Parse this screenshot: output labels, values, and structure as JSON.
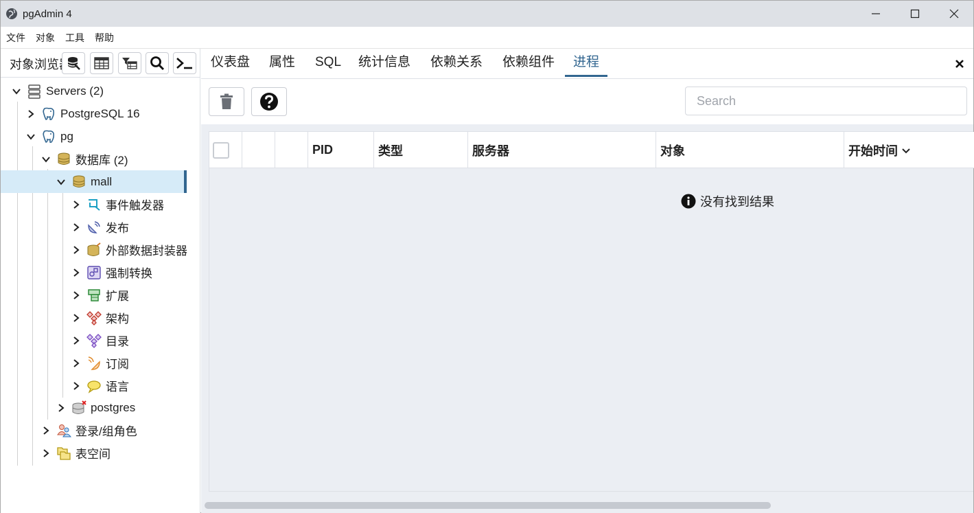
{
  "window": {
    "title": "pgAdmin 4"
  },
  "menu": [
    "文件",
    "对象",
    "工具",
    "帮助"
  ],
  "browser": {
    "title": "对象浏览器",
    "tree": [
      {
        "label": "Servers (2)",
        "icon": "servers-icon",
        "level": 0,
        "expanded": true
      },
      {
        "label": "PostgreSQL 16",
        "icon": "postgres-elephant-icon",
        "level": 1,
        "expanded": false
      },
      {
        "label": "pg",
        "icon": "postgres-elephant-icon",
        "level": 1,
        "expanded": true
      },
      {
        "label": "数据库 (2)",
        "icon": "databases-icon",
        "level": 2,
        "expanded": true
      },
      {
        "label": "mall",
        "icon": "database-icon",
        "level": 3,
        "expanded": true,
        "selected": true
      },
      {
        "label": "事件触发器",
        "icon": "event-trigger-icon",
        "level": 4
      },
      {
        "label": "发布",
        "icon": "publication-icon",
        "level": 4
      },
      {
        "label": "外部数据封装器",
        "icon": "fdw-icon",
        "level": 4
      },
      {
        "label": "强制转换",
        "icon": "cast-icon",
        "level": 4
      },
      {
        "label": "扩展",
        "icon": "extension-icon",
        "level": 4
      },
      {
        "label": "架构",
        "icon": "schema-icon",
        "level": 4
      },
      {
        "label": "目录",
        "icon": "catalog-icon",
        "level": 4
      },
      {
        "label": "订阅",
        "icon": "subscription-icon",
        "level": 4
      },
      {
        "label": "语言",
        "icon": "language-icon",
        "level": 4
      },
      {
        "label": "postgres",
        "icon": "database-disconnected-icon",
        "level": 3
      },
      {
        "label": "登录/组角色",
        "icon": "roles-icon",
        "level": 2
      },
      {
        "label": "表空间",
        "icon": "tablespaces-icon",
        "level": 2
      }
    ]
  },
  "tabs": [
    "仪表盘",
    "属性",
    "SQL",
    "统计信息",
    "依赖关系",
    "依赖组件",
    "进程"
  ],
  "active_tab": "进程",
  "search": {
    "placeholder": "Search",
    "value": ""
  },
  "grid": {
    "columns": [
      "PID",
      "类型",
      "服务器",
      "对象",
      "开始时间"
    ],
    "sort_column": "开始时间",
    "empty_message": "没有找到结果"
  },
  "colors": {
    "accent": "#326690",
    "selected_bg": "#d6ebf8",
    "panel_bg": "#ebeef3"
  }
}
